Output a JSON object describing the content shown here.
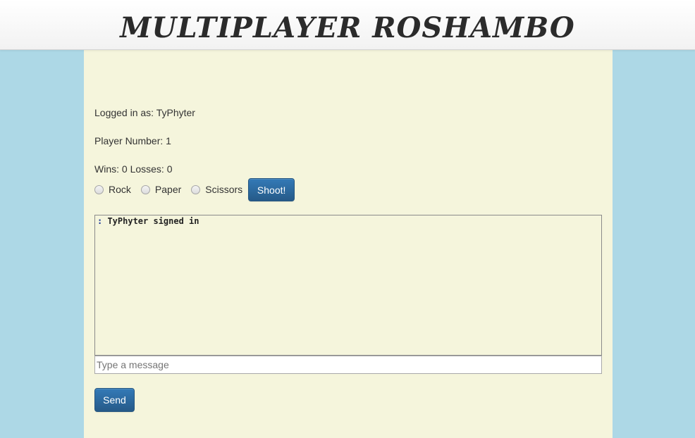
{
  "header": {
    "title": "MULTIPLAYER ROSHAMBO"
  },
  "player": {
    "logged_in_label": "Logged in as: TyPhyter",
    "player_number_label": "Player Number: 1",
    "record_label": "Wins: 0 Losses: 0"
  },
  "choices": {
    "options": [
      {
        "label": "Rock",
        "selected": false
      },
      {
        "label": "Paper",
        "selected": false
      },
      {
        "label": "Scissors",
        "selected": false
      }
    ],
    "shoot_label": "Shoot!"
  },
  "chat": {
    "messages": [
      {
        "sender": ":",
        "text": " TyPhyter signed in"
      }
    ],
    "input_value": "",
    "input_placeholder": "Type a message",
    "send_label": "Send"
  },
  "colors": {
    "page_background": "#add8e6",
    "content_background": "#f5f5dc",
    "button_primary": "#337ab7"
  }
}
